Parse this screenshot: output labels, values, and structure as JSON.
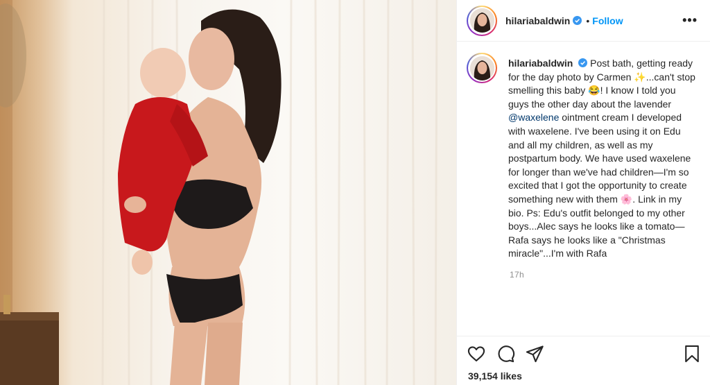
{
  "post": {
    "username": "hilariabaldwin",
    "follow_label": "Follow",
    "more_label": "•••",
    "separator": "•",
    "caption_parts": {
      "intro": "Post bath, getting ready for the day photo by Carmen ",
      "emoji_sparkle": "✨",
      "part2": "...can't stop smelling this baby ",
      "emoji_laugh": "😂",
      "part3": "! I know I told you guys the other day about the lavender ",
      "mention": "@waxelene",
      "part4": " ointment cream I developed with waxelene. I've been using it on Edu and all my children, as well as my postpartum body. We have used waxelene for longer than we've had children—I'm so excited that I got the opportunity to create something new with them ",
      "emoji_flower": "🌸",
      "part5": ". Link in my bio. Ps: Edu's outfit belonged to my other boys...Alec says he looks like a tomato—Rafa says he looks like a \"Christmas miracle\"...I'm with Rafa"
    },
    "time": "17h",
    "likes_count": "39,154",
    "likes_word": "likes"
  },
  "colors": {
    "follow": "#0095f6",
    "mention": "#00376b",
    "verified": "#3897f0",
    "meta_gray": "#8e8e8e"
  },
  "icons": {
    "like": "heart-icon",
    "comment": "comment-icon",
    "share": "paper-plane-icon",
    "save": "bookmark-icon",
    "verified": "verified-badge-icon"
  }
}
